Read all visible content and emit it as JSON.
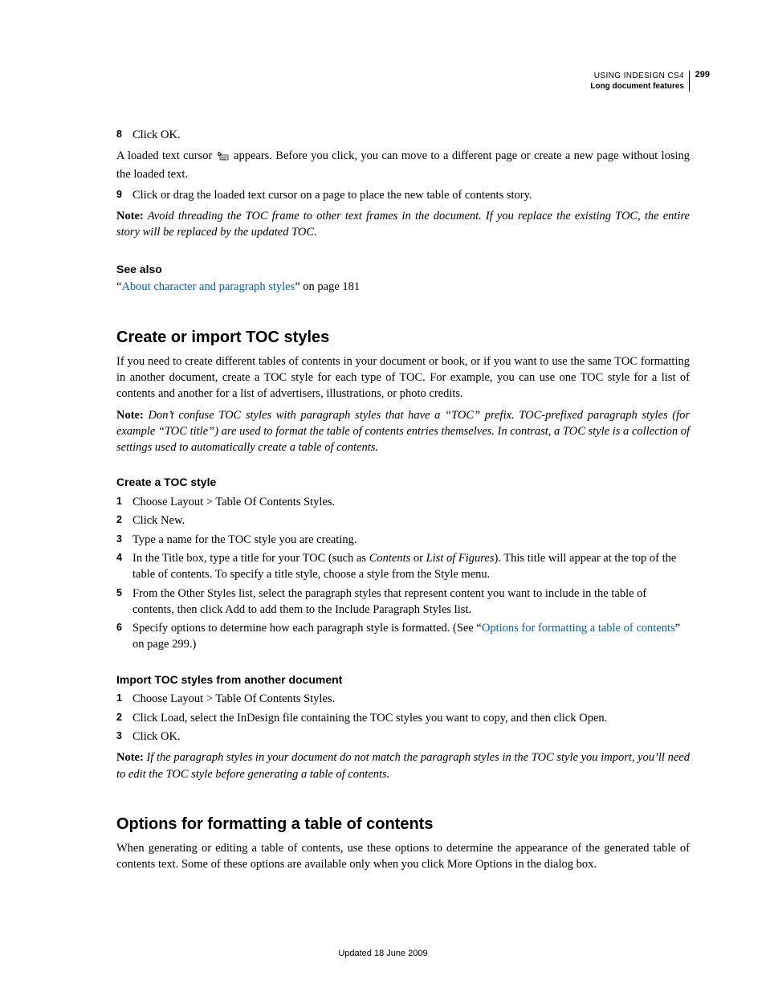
{
  "header": {
    "line1": "USING INDESIGN CS4",
    "line2": "Long document features",
    "pageNumber": "299"
  },
  "steps_top": [
    {
      "n": "8",
      "t": "Click OK."
    }
  ],
  "loaded_pre": "A loaded text cursor ",
  "loaded_post": " appears. Before you click, you can move to a different page or create a new page without losing the loaded text.",
  "step9": {
    "n": "9",
    "t": "Click or drag the loaded text cursor on a page to place the new table of contents story."
  },
  "note1_label": "Note:",
  "note1": " Avoid threading the TOC frame to other text frames in the document. If you replace the existing TOC, the entire story will be replaced by the updated TOC.",
  "seealso_heading": "See also",
  "seealso_q1": "“",
  "seealso_link": "About character and paragraph styles",
  "seealso_q2": "” on page 181",
  "h2a": "Create or import TOC styles",
  "p_intro": "If you need to create different tables of contents in your document or book, or if you want to use the same TOC formatting in another document, create a TOC style for each type of TOC. For example, you can use one TOC style for a list of contents and another for a list of advertisers, illustrations, or photo credits.",
  "note2_label": "Note:",
  "note2": " Don’t confuse TOC styles with paragraph styles that have a “TOC” prefix. TOC-prefixed paragraph styles (for example “TOC title”) are used to format the table of contents entries themselves. In contrast, a TOC style is a collection of settings used to automatically create a table of contents.",
  "sub_create": "Create a TOC style",
  "create_steps": {
    "s1": "Choose Layout > Table Of Contents Styles.",
    "s2": "Click New.",
    "s3": "Type a name for the TOC style you are creating.",
    "s4_pre": "In the Title box, type a title for your TOC (such as ",
    "s4_i1": "Contents",
    "s4_mid": " or ",
    "s4_i2": "List of Figures",
    "s4_post": "). This title will appear at the top of the table of contents. To specify a title style, choose a style from the Style menu.",
    "s5": "From the Other Styles list, select the paragraph styles that represent content you want to include in the table of contents, then click Add to add them to the Include Paragraph Styles list.",
    "s6_pre": "Specify options to determine how each paragraph style is formatted. (See “",
    "s6_link": "Options for formatting a table of contents",
    "s6_post": "” on page 299.)"
  },
  "sub_import": "Import TOC styles from another document",
  "import_steps": {
    "s1": "Choose Layout > Table Of Contents Styles.",
    "s2": "Click Load, select the InDesign file containing the TOC styles you want to copy, and then click Open.",
    "s3": "Click OK."
  },
  "note3_label": "Note:",
  "note3": " If the paragraph styles in your document do not match the paragraph styles in the TOC style you import, you’ll need to edit the TOC style before generating a table of contents.",
  "h2b": "Options for formatting a table of contents",
  "p_options": "When generating or editing a table of contents, use these options to determine the appearance of the generated table of contents text. Some of these options are available only when you click More Options in the dialog box.",
  "footer": "Updated 18 June 2009"
}
